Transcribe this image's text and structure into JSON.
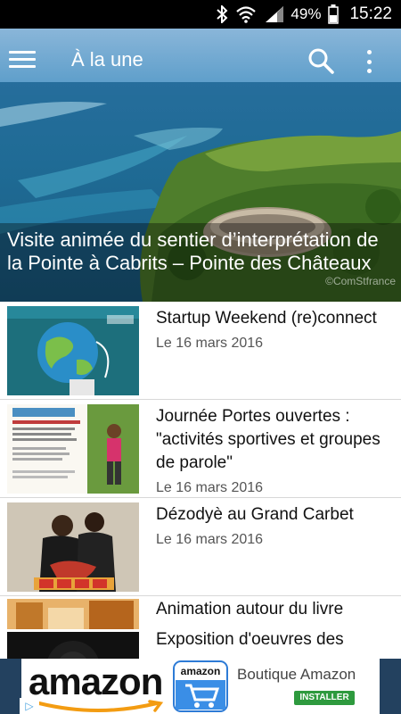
{
  "status_bar": {
    "battery": "49%",
    "time": "15:22",
    "icons": [
      "bluetooth-icon",
      "wifi-icon",
      "signal-icon",
      "battery-icon"
    ]
  },
  "app_bar": {
    "title": "À la une",
    "icons": [
      "menu-icon",
      "search-icon",
      "more-vert-icon"
    ]
  },
  "featured": {
    "title": "Visite animée du sentier d’interprétation de la Pointe à Cabrits – Pointe des Châteaux",
    "watermark": "©ComStfrance"
  },
  "news": [
    {
      "title": "Startup Weekend (re)connect",
      "date": "Le 16 mars 2016"
    },
    {
      "title": "Journée Portes ouvertes : \"activités sportives et groupes de parole\"",
      "date": "Le 16 mars 2016"
    },
    {
      "title": "Dézodyè au Grand Carbet",
      "date": "Le 16 mars 2016"
    },
    {
      "title": "Animation autour du livre",
      "date": ""
    },
    {
      "title": "Exposition d'oeuvres des",
      "date": ""
    }
  ],
  "ad": {
    "brand": "amazon",
    "app_label": "Boutique Amazon",
    "install": "INSTALLER",
    "cart_brand": "amazon"
  },
  "colors": {
    "accent": "#2e9a3e",
    "ad_background": "#23415f"
  }
}
